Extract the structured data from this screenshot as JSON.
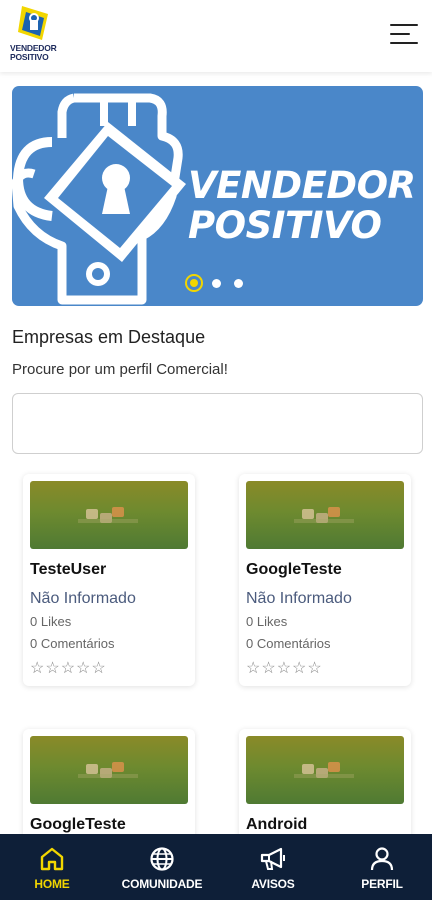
{
  "header": {
    "logo_text_line1": "VENDEDOR",
    "logo_text_line2": "POSITIVO"
  },
  "banner": {
    "title_line1": "VENDEDOR",
    "title_line2": "POSITIVO",
    "slide_count": 3,
    "active_slide": 1,
    "bg_color": "#4a87c9",
    "active_dot_color": "#f2d600"
  },
  "section": {
    "title": "Empresas em Destaque",
    "subtitle": "Procure por um perfil Comercial!",
    "search_value": ""
  },
  "companies": [
    {
      "name": "TesteUser",
      "status": "Não Informado",
      "likes": "0 Likes",
      "comments": "0 Comentários",
      "stars": "☆☆☆☆☆"
    },
    {
      "name": "GoogleTeste",
      "status": "Não Informado",
      "likes": "0 Likes",
      "comments": "0 Comentários",
      "stars": "☆☆☆☆☆"
    },
    {
      "name": "GoogleTeste"
    },
    {
      "name": "Android"
    }
  ],
  "nav": {
    "items": [
      {
        "label": "HOME",
        "icon": "home-icon",
        "active": true
      },
      {
        "label": "COMUNIDADE",
        "icon": "globe-icon",
        "active": false
      },
      {
        "label": "AVISOS",
        "icon": "megaphone-icon",
        "active": false
      },
      {
        "label": "PERFIL",
        "icon": "user-icon",
        "active": false
      }
    ],
    "active_color": "#f2d600",
    "bg_color": "#0e1f38"
  }
}
